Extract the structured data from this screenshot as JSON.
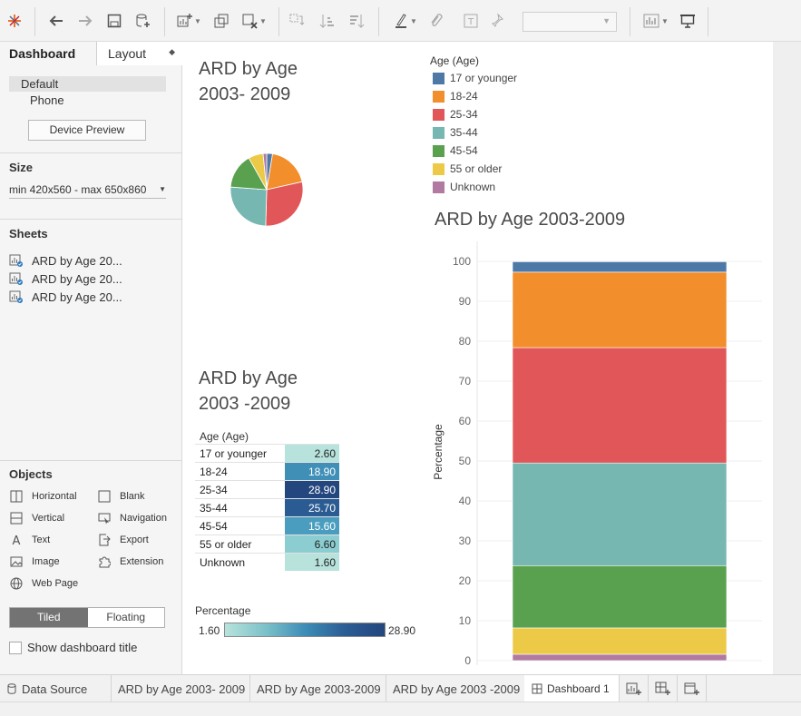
{
  "sidebar": {
    "tabs": {
      "dashboard": "Dashboard",
      "layout": "Layout"
    },
    "device": {
      "default": "Default",
      "phone": "Phone",
      "preview_button": "Device Preview"
    },
    "size": {
      "title": "Size",
      "value": "min 420x560 - max 650x860"
    },
    "sheets": {
      "title": "Sheets",
      "items": [
        "ARD by Age 20...",
        "ARD by Age 20...",
        "ARD by Age 20..."
      ]
    },
    "objects": {
      "title": "Objects",
      "items": [
        {
          "label": "Horizontal",
          "icon": "horizontal-container-icon"
        },
        {
          "label": "Blank",
          "icon": "blank-icon"
        },
        {
          "label": "Vertical",
          "icon": "vertical-container-icon"
        },
        {
          "label": "Navigation",
          "icon": "navigation-icon"
        },
        {
          "label": "Text",
          "icon": "text-icon"
        },
        {
          "label": "Export",
          "icon": "export-icon"
        },
        {
          "label": "Image",
          "icon": "image-icon"
        },
        {
          "label": "Extension",
          "icon": "extension-icon"
        },
        {
          "label": "Web Page",
          "icon": "globe-icon"
        }
      ]
    },
    "layout_toggle": {
      "tiled": "Tiled",
      "floating": "Floating"
    },
    "show_title_label": "Show dashboard title"
  },
  "dashboard": {
    "pie_title_line1": "ARD by Age",
    "pie_title_line2": "2003- 2009",
    "table_title_line1": "ARD by Age",
    "table_title_line2": "2003 -2009",
    "bar_title": "ARD by Age 2003-2009",
    "legend": {
      "title": "Age (Age)",
      "items": [
        {
          "label": "17 or younger",
          "color": "#4e79a7"
        },
        {
          "label": "18-24",
          "color": "#f28e2b"
        },
        {
          "label": "25-34",
          "color": "#e15759"
        },
        {
          "label": "35-44",
          "color": "#76b7b2"
        },
        {
          "label": "45-54",
          "color": "#59a14f"
        },
        {
          "label": "55 or older",
          "color": "#edc948"
        },
        {
          "label": "Unknown",
          "color": "#b07aa1"
        }
      ]
    },
    "table": {
      "header": "Age (Age)",
      "rows": [
        {
          "label": "17 or younger",
          "value": "2.60",
          "bg": "#b7e3dc",
          "fg": "#222222"
        },
        {
          "label": "18-24",
          "value": "18.90",
          "bg": "#3f8fb6",
          "fg": "#ffffff"
        },
        {
          "label": "25-34",
          "value": "28.90",
          "bg": "#24467e",
          "fg": "#ffffff"
        },
        {
          "label": "35-44",
          "value": "25.70",
          "bg": "#2b5b93",
          "fg": "#ffffff"
        },
        {
          "label": "45-54",
          "value": "15.60",
          "bg": "#4a9dbf",
          "fg": "#ffffff"
        },
        {
          "label": "55 or older",
          "value": "6.60",
          "bg": "#8ccdd1",
          "fg": "#222222"
        },
        {
          "label": "Unknown",
          "value": "1.60",
          "bg": "#b7e3dc",
          "fg": "#222222"
        }
      ]
    },
    "gradient": {
      "title": "Percentage",
      "min": "1.60",
      "max": "28.90"
    }
  },
  "chart_data": [
    {
      "type": "pie",
      "categories": [
        "17 or younger",
        "18-24",
        "25-34",
        "35-44",
        "45-54",
        "55 or older",
        "Unknown"
      ],
      "values": [
        2.6,
        18.9,
        28.9,
        25.7,
        15.6,
        6.6,
        1.6
      ],
      "colors": [
        "#4e79a7",
        "#f28e2b",
        "#e15759",
        "#76b7b2",
        "#59a14f",
        "#edc948",
        "#b07aa1"
      ]
    },
    {
      "type": "bar",
      "stacked": true,
      "categories": [
        ""
      ],
      "series": [
        {
          "name": "Unknown",
          "values": [
            1.6
          ],
          "color": "#b07aa1"
        },
        {
          "name": "55 or older",
          "values": [
            6.6
          ],
          "color": "#edc948"
        },
        {
          "name": "45-54",
          "values": [
            15.6
          ],
          "color": "#59a14f"
        },
        {
          "name": "35-44",
          "values": [
            25.7
          ],
          "color": "#76b7b2"
        },
        {
          "name": "25-34",
          "values": [
            28.9
          ],
          "color": "#e15759"
        },
        {
          "name": "18-24",
          "values": [
            18.9
          ],
          "color": "#f28e2b"
        },
        {
          "name": "17 or younger",
          "values": [
            2.6
          ],
          "color": "#4e79a7"
        }
      ],
      "ylabel": "Percentage",
      "ylim": [
        0,
        100
      ],
      "yticks": [
        0,
        10,
        20,
        30,
        40,
        50,
        60,
        70,
        80,
        90,
        100
      ],
      "grid": true
    }
  ],
  "bottom_tabs": {
    "data_source": "Data Source",
    "sheets": [
      "ARD by Age 2003- 2009",
      "ARD by Age 2003-2009",
      "ARD by Age 2003 -2009"
    ],
    "active": "Dashboard 1"
  }
}
